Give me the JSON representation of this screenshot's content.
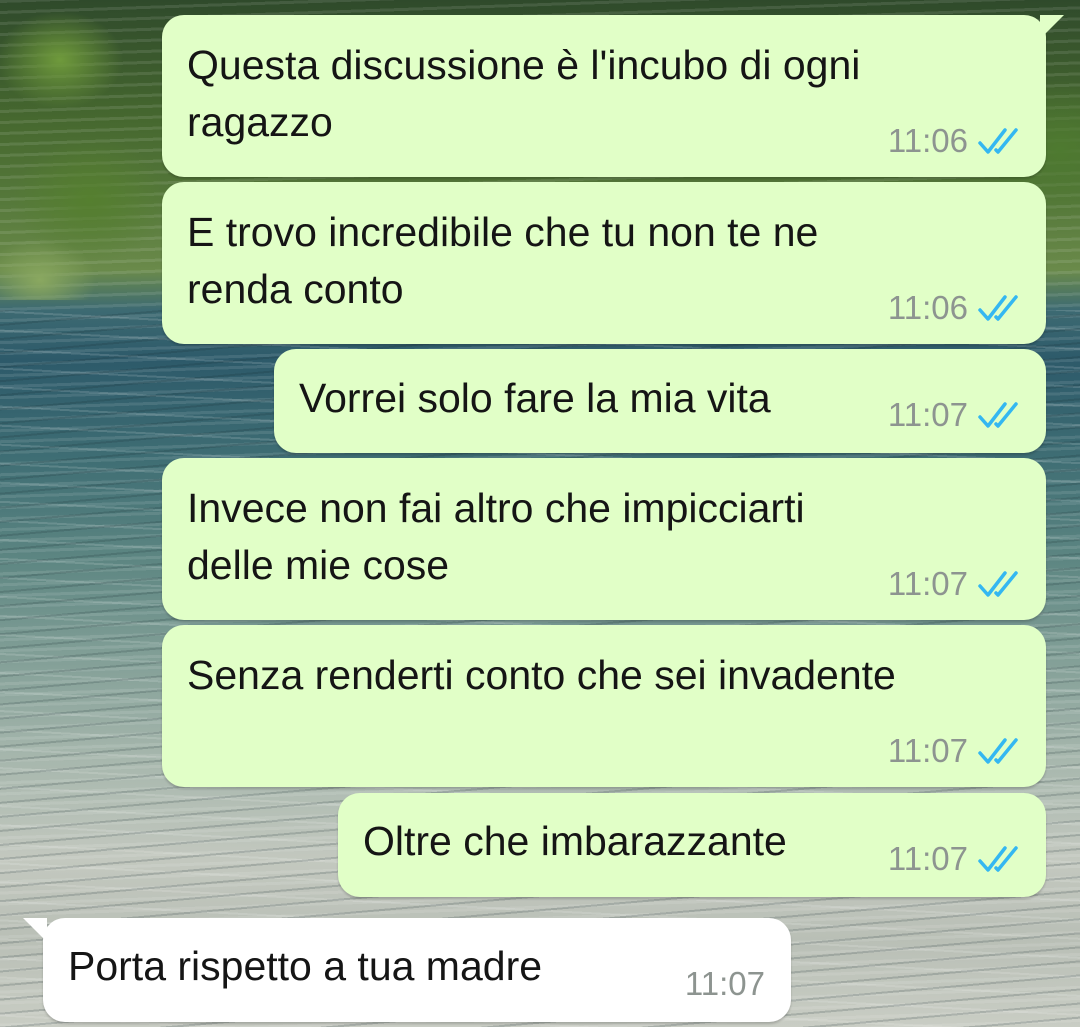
{
  "colors": {
    "outgoing_bubble": "#e1ffc7",
    "incoming_bubble": "#ffffff",
    "timestamp": "#8d9490",
    "read_ticks": "#34b7f1"
  },
  "icons": {
    "read_receipt": "double-check-icon"
  },
  "messages": [
    {
      "direction": "out",
      "text": "Questa discussione è l'incubo di ogni\nragazzo",
      "time": "11:06",
      "status": "read"
    },
    {
      "direction": "out",
      "text": "E trovo incredibile che tu non te ne\nrenda conto",
      "time": "11:06",
      "status": "read"
    },
    {
      "direction": "out",
      "text": "Vorrei solo fare la mia vita",
      "time": "11:07",
      "status": "read"
    },
    {
      "direction": "out",
      "text": "Invece non fai altro che impicciarti\ndelle mie cose",
      "time": "11:07",
      "status": "read"
    },
    {
      "direction": "out",
      "text": "Senza renderti conto che sei invadente",
      "time": "11:07",
      "status": "read"
    },
    {
      "direction": "out",
      "text": "Oltre che imbarazzante",
      "time": "11:07",
      "status": "read"
    },
    {
      "direction": "in",
      "text": "Porta rispetto a tua madre",
      "time": "11:07"
    }
  ]
}
